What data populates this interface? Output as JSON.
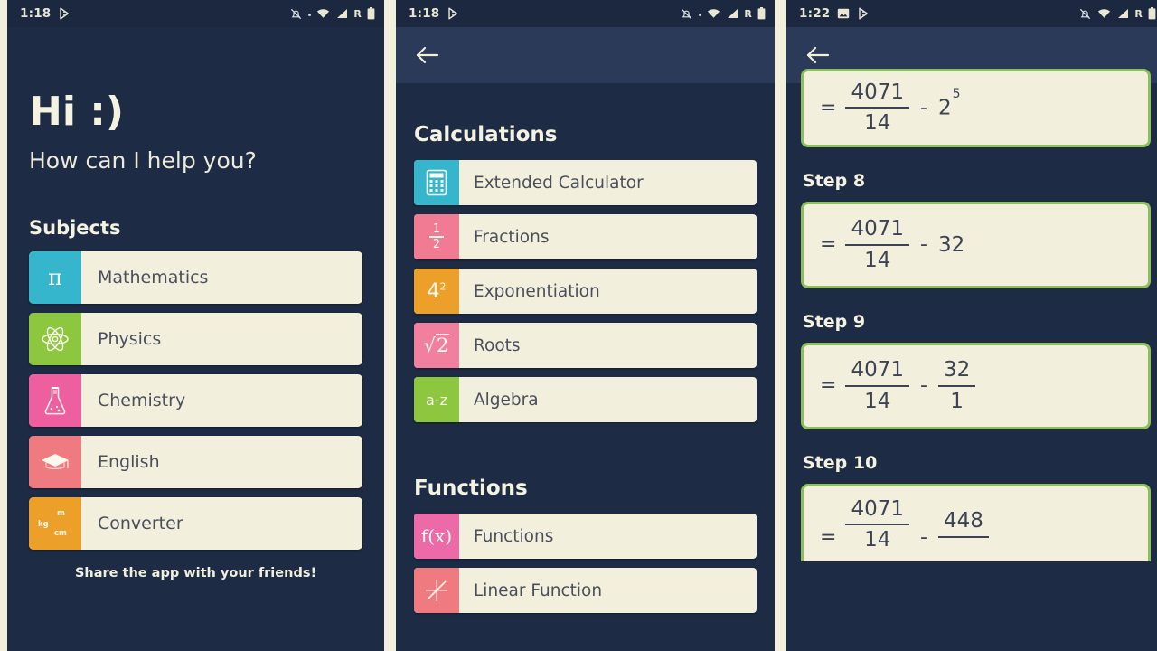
{
  "theme": {
    "panel_bg": "#1d2b45",
    "statusbar_bg": "#1b2840",
    "appbar_bg": "#2a3a58",
    "card_bg": "#f2f0dc",
    "card_text": "#4a4f5c",
    "page_bg": "#f2f0dc",
    "step_border": "#8cc05a"
  },
  "panel1": {
    "status": {
      "clock": "1:18",
      "left_icons": [
        "play-store-icon"
      ],
      "right_icons": [
        "bell-off-icon",
        "dot-icon",
        "wifi-icon",
        "signal-icon",
        "roaming-icon",
        "battery-icon"
      ],
      "roaming_letter": "R"
    },
    "greeting": "Hi :)",
    "subgreeting": "How can I help you?",
    "section_title": "Subjects",
    "subjects": [
      {
        "label": "Mathematics",
        "icon": "pi-icon",
        "glyph": "π",
        "color": "#35b6cd"
      },
      {
        "label": "Physics",
        "icon": "atom-icon",
        "glyph": "",
        "color": "#8dc63f"
      },
      {
        "label": "Chemistry",
        "icon": "flask-icon",
        "glyph": "",
        "color": "#ed5f9e"
      },
      {
        "label": "English",
        "icon": "graduation-cap-icon",
        "glyph": "",
        "color": "#ef7b81"
      },
      {
        "label": "Converter",
        "icon": "unit-converter-icon",
        "glyph": "",
        "color": "#eda029",
        "units": {
          "m": "m",
          "kg": "kg",
          "cm": "cm"
        }
      }
    ],
    "share_note": "Share the app with your friends!"
  },
  "panel2": {
    "status": {
      "clock": "1:18",
      "left_icons": [
        "play-store-icon"
      ],
      "right_icons": [
        "bell-off-icon",
        "dot-icon",
        "wifi-icon",
        "signal-icon",
        "roaming-icon",
        "battery-icon"
      ],
      "roaming_letter": "R"
    },
    "back_label": "back",
    "sections": [
      {
        "title": "Calculations",
        "items": [
          {
            "label": "Extended Calculator",
            "icon": "calculator-icon",
            "color": "#35b6cd"
          },
          {
            "label": "Fractions",
            "icon": "fraction-icon",
            "color": "#f07b93",
            "num": "1",
            "den": "2"
          },
          {
            "label": "Exponentiation",
            "icon": "power-icon",
            "color": "#eda029",
            "base": "4",
            "exp": "2"
          },
          {
            "label": "Roots",
            "icon": "square-root-icon",
            "color": "#f0809e",
            "radicand": "2"
          },
          {
            "label": "Algebra",
            "icon": "a-z-icon",
            "color": "#8dc63f",
            "text": "a-z"
          }
        ]
      },
      {
        "title": "Functions",
        "items": [
          {
            "label": "Functions",
            "icon": "f-of-x-icon",
            "color": "#ec6aa8",
            "text": "f(x)"
          },
          {
            "label": "Linear Function",
            "icon": "linear-graph-icon",
            "color": "#ef7b81"
          }
        ]
      }
    ]
  },
  "panel3": {
    "status": {
      "clock": "1:22",
      "left_icons": [
        "screenshot-icon",
        "play-store-icon"
      ],
      "right_icons": [
        "bell-off-icon",
        "wifi-icon",
        "signal-icon",
        "roaming-icon",
        "battery-icon"
      ],
      "roaming_letter": "R"
    },
    "back_label": "back",
    "steps": [
      {
        "label": "",
        "partial_top": true,
        "expression": {
          "eq": "=",
          "frac": {
            "num": "4071",
            "den": "14"
          },
          "op": "-",
          "power": {
            "base": "2",
            "exp": "5"
          }
        }
      },
      {
        "label": "Step 8",
        "expression": {
          "eq": "=",
          "frac": {
            "num": "4071",
            "den": "14"
          },
          "op": "-",
          "term": "32"
        }
      },
      {
        "label": "Step 9",
        "expression": {
          "eq": "=",
          "frac": {
            "num": "4071",
            "den": "14"
          },
          "op": "-",
          "frac2": {
            "num": "32",
            "den": "1"
          }
        }
      },
      {
        "label": "Step 10",
        "expression": {
          "eq": "=",
          "frac": {
            "num": "4071",
            "den": "14"
          },
          "op": "-",
          "frac2": {
            "num": "448",
            "den": ""
          }
        }
      }
    ]
  }
}
